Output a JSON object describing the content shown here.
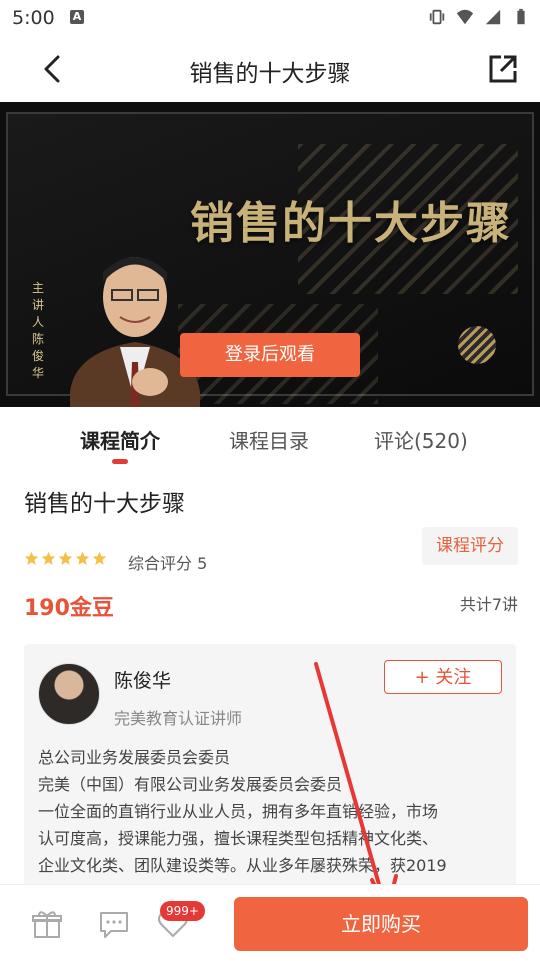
{
  "status_bar": {
    "time": "5:00",
    "keyboard_icon_letter": "A"
  },
  "header": {
    "title": "销售的十大步骤"
  },
  "video": {
    "label_text": "主讲人 陈俊华",
    "banner_title": "销售的十大步骤",
    "login_button": "登录后观看"
  },
  "tabs": [
    {
      "label": "课程简介",
      "active": true
    },
    {
      "label": "课程目录",
      "active": false
    },
    {
      "label": "评论(520)",
      "active": false
    }
  ],
  "course": {
    "title": "销售的十大步骤",
    "rating_button": "课程评分",
    "stars": 5,
    "rating_text": "综合评分 5",
    "price": "190金豆",
    "lessons": "共计7讲"
  },
  "teacher": {
    "name": "陈俊华",
    "certification": "完美教育认证讲师",
    "follow_button": "+ 关注",
    "bio_lines": [
      "总公司业务发展委员会委员",
      "完美（中国）有限公司业务发展委员会委员",
      "一位全面的直销行业从业人员，拥有多年直销经验，市场",
      "认可度高，授课能力强，擅长课程类型包括精神文化类、",
      "企业文化类、团队建设类等。从业多年屡获殊荣，获2019"
    ]
  },
  "bottom_bar": {
    "like_badge": "999+",
    "buy_button": "立即购买"
  },
  "colors": {
    "accent": "#f0653f",
    "price": "#e8533a",
    "indicator": "#e53935",
    "gold": "#c9b27a"
  }
}
